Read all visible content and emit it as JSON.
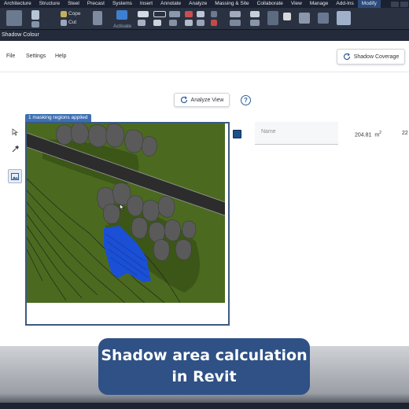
{
  "ribbon": {
    "tabs": [
      "Architecture",
      "Structure",
      "Steel",
      "Precast",
      "Systems",
      "Insert",
      "Annotate",
      "Analyze",
      "Massing & Site",
      "Collaborate",
      "View",
      "Manage",
      "Add-Ins",
      "Modify"
    ],
    "active_tab": "Modify",
    "cope_label": "Cope",
    "cut_label": "Cut",
    "activate_label": "Activate"
  },
  "window": {
    "title": "Shadow Colour",
    "menu": [
      "File",
      "Settings",
      "Help"
    ],
    "shadow_coverage_label": "Shadow Coverage",
    "analyze_view_label": "Analyze View",
    "help_glyph": "?"
  },
  "viewport": {
    "mask_label": "1 masking regions applied"
  },
  "results": {
    "swatch_color": "#1d4f8a",
    "name_placeholder": "Name",
    "area_value": "204.81",
    "area_unit": "m",
    "area_exp": "2",
    "area_second": "22"
  },
  "caption": {
    "line1": "Shadow area calculation",
    "line2": "in Revit"
  },
  "colors": {
    "grass": "#4b6a1f",
    "road": "#2c2c2c",
    "tree": "#5a5a5a",
    "shadow_region": "#1a4fd6",
    "accent": "#3d6fb3"
  }
}
